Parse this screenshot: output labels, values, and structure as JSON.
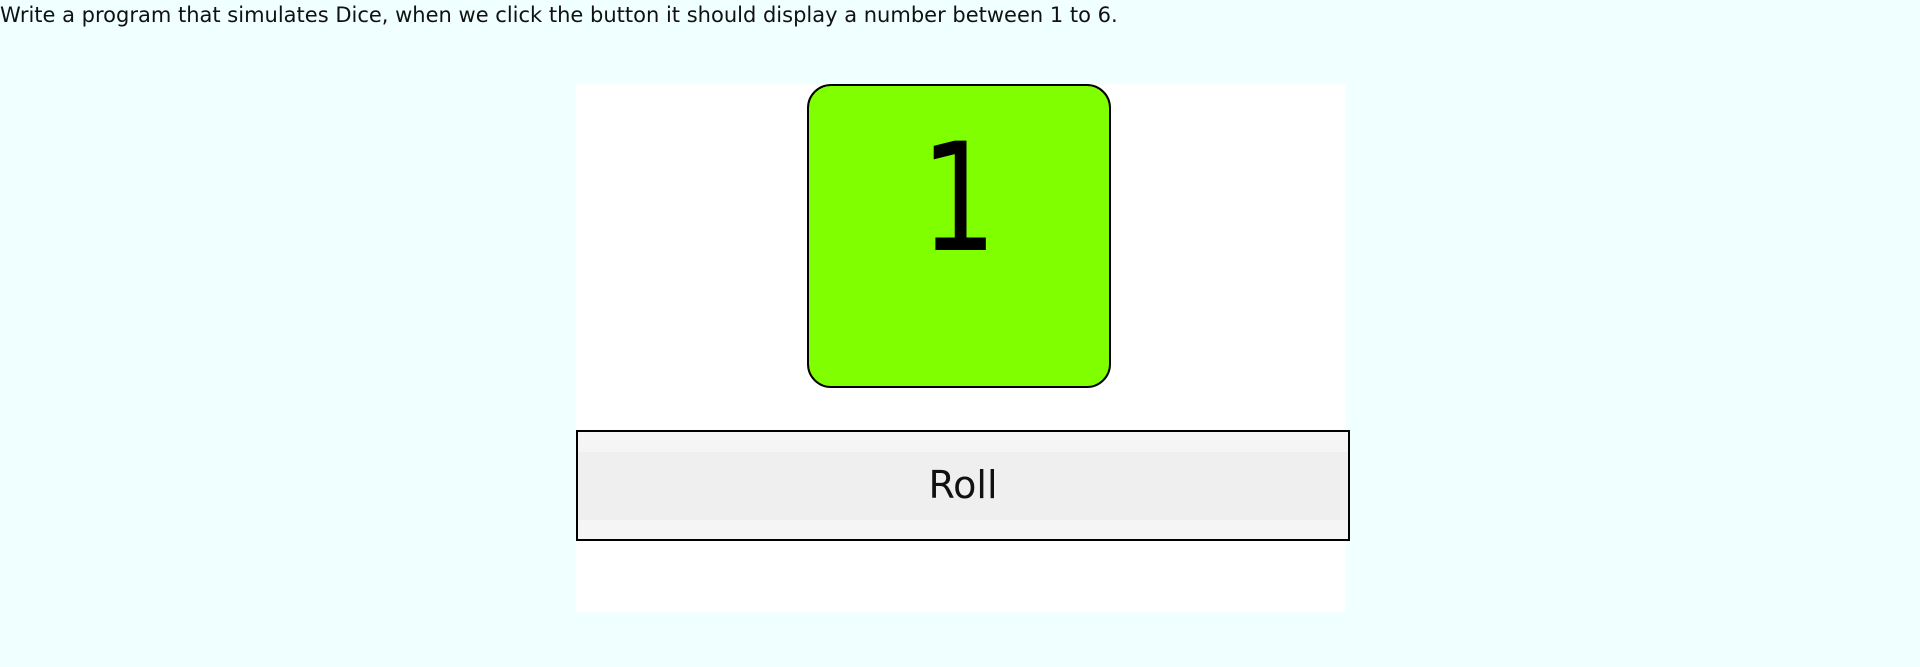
{
  "instructions": "Write a program that simulates Dice, when we click the button it should display a number between 1 to 6.",
  "die": {
    "value": "1",
    "color": "#80ff00"
  },
  "roll_button": {
    "label": "Roll"
  }
}
